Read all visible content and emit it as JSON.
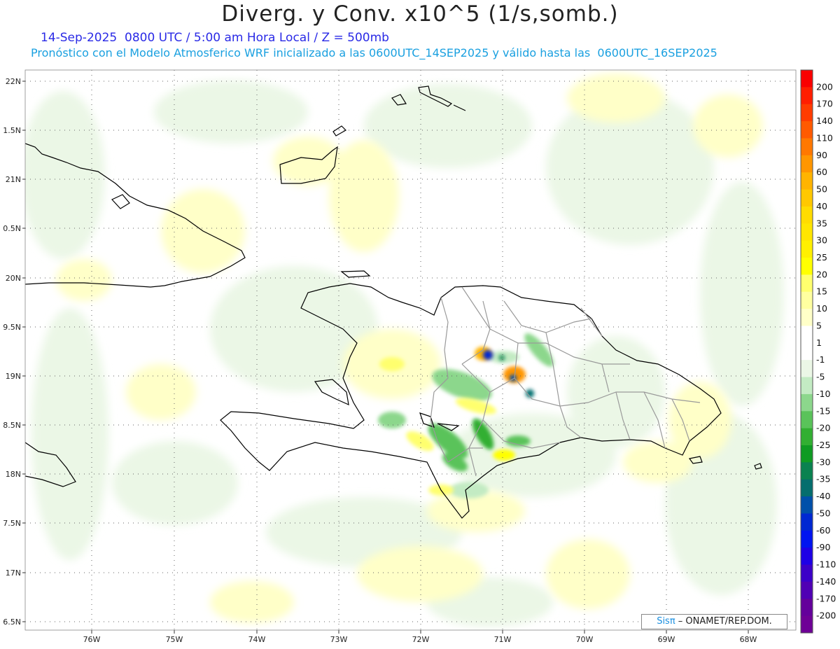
{
  "header": {
    "title": "Diverg. y Conv. x10^5 (1/s,somb.)",
    "subtitle": "14-Sep-2025  0800 UTC / 5:00 am Hora Local / Z = 500mb",
    "model_line": "Pronóstico con el Modelo Atmosferico WRF inicializado a las 0600UTC_14SEP2025 y válido hasta las  0600UTC_16SEP2025"
  },
  "axes": {
    "lat_labels": [
      "22N",
      "1.5N",
      "21N",
      "0.5N",
      "20N",
      "9.5N",
      "19N",
      "8.5N",
      "18N",
      "7.5N",
      "17N",
      "6.5N"
    ],
    "lon_labels": [
      "76W",
      "75W",
      "74W",
      "73W",
      "72W",
      "71W",
      "70W",
      "69W",
      "68W"
    ]
  },
  "legend": {
    "levels": [
      {
        "label": "200",
        "color": "#fa0000"
      },
      {
        "label": "170",
        "color": "#ff1e00"
      },
      {
        "label": "140",
        "color": "#ff3c00"
      },
      {
        "label": "110",
        "color": "#ff5a00"
      },
      {
        "label": "90",
        "color": "#ff7800"
      },
      {
        "label": "60",
        "color": "#ff9600"
      },
      {
        "label": "50",
        "color": "#ffb400"
      },
      {
        "label": "40",
        "color": "#ffc800"
      },
      {
        "label": "35",
        "color": "#ffdc00"
      },
      {
        "label": "30",
        "color": "#ffe600"
      },
      {
        "label": "25",
        "color": "#fff000"
      },
      {
        "label": "20",
        "color": "#ffff00"
      },
      {
        "label": "15",
        "color": "#ffff6e"
      },
      {
        "label": "10",
        "color": "#ffffa0"
      },
      {
        "label": "5",
        "color": "#ffffc8"
      },
      {
        "label": "1",
        "color": "#ffffff"
      },
      {
        "label": "-1",
        "color": "#ffffff"
      },
      {
        "label": "-5",
        "color": "#ebf7e6"
      },
      {
        "label": "-10",
        "color": "#c3ebc3"
      },
      {
        "label": "-15",
        "color": "#8cd78c"
      },
      {
        "label": "-20",
        "color": "#5ac35a"
      },
      {
        "label": "-25",
        "color": "#32af32"
      },
      {
        "label": "-30",
        "color": "#0f9b23"
      },
      {
        "label": "-35",
        "color": "#0a8250"
      },
      {
        "label": "-40",
        "color": "#056e6e"
      },
      {
        "label": "-50",
        "color": "#0050aa"
      },
      {
        "label": "-60",
        "color": "#0028d2"
      },
      {
        "label": "-90",
        "color": "#0014f0"
      },
      {
        "label": "-110",
        "color": "#1e00e6"
      },
      {
        "label": "-140",
        "color": "#3c00c8"
      },
      {
        "label": "-170",
        "color": "#5000b4"
      },
      {
        "label": "-200",
        "color": "#64009b"
      },
      {
        "label": "",
        "color": "#6e0096"
      }
    ]
  },
  "credit": {
    "logo": "Sisπ",
    "text": " – ONAMET/REP.DOM."
  }
}
